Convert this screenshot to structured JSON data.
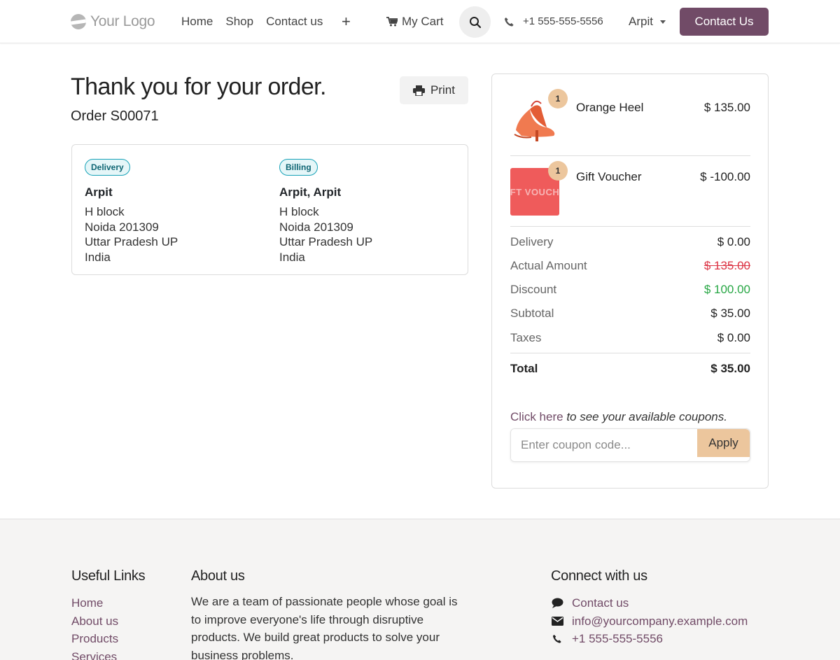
{
  "header": {
    "logo_text": "Your Logo",
    "nav": [
      "Home",
      "Shop",
      "Contact us"
    ],
    "plus": "+",
    "cart_label": "My Cart",
    "phone": "+1 555-555-5556",
    "user": "Arpit",
    "cta": "Contact Us"
  },
  "main": {
    "title": "Thank you for your order.",
    "order_no": "Order S00071",
    "print_label": "Print",
    "delivery": {
      "badge": "Delivery",
      "name": "Arpit",
      "lines": [
        "H block",
        "Noida 201309",
        "Uttar Pradesh UP",
        "India"
      ]
    },
    "billing": {
      "badge": "Billing",
      "name": "Arpit, Arpit",
      "lines": [
        "H block",
        "Noida 201309",
        "Uttar Pradesh UP",
        "India"
      ]
    }
  },
  "summary": {
    "items": [
      {
        "name": "Orange Heel",
        "price": "$ 135.00",
        "qty": "1",
        "thumb": "heel-image"
      },
      {
        "name": "Gift Voucher",
        "price": "$ -100.00",
        "qty": "1",
        "thumb_text": "FT VOUCH"
      }
    ],
    "rows": {
      "delivery": {
        "label": "Delivery",
        "value": "$ 0.00"
      },
      "actual": {
        "label": "Actual Amount",
        "value": "$ 135.00"
      },
      "discount": {
        "label": "Discount",
        "value": "$ 100.00"
      },
      "subtotal": {
        "label": "Subtotal",
        "value": "$ 35.00"
      },
      "taxes": {
        "label": "Taxes",
        "value": "$ 0.00"
      },
      "total": {
        "label": "Total",
        "value": "$ 35.00"
      }
    },
    "coupon_link": "Click here",
    "coupon_text": " to see your available coupons.",
    "coupon_placeholder": "Enter coupon code...",
    "apply_label": "Apply"
  },
  "footer": {
    "links_title": "Useful Links",
    "links": [
      "Home",
      "About us",
      "Products",
      "Services"
    ],
    "about_title": "About us",
    "about_text": "We are a team of passionate people whose goal is to improve everyone's life through disruptive products. We build great products to solve your business problems.",
    "connect_title": "Connect with us",
    "connect": {
      "contact": "Contact us",
      "email": "info@yourcompany.example.com",
      "phone": "+1 555-555-5556"
    }
  },
  "colors": {
    "brand": "#714b67",
    "accent": "#ecc69d",
    "badge": "#17a2b8",
    "discount": "#28a745",
    "strike": "#dc3545"
  }
}
